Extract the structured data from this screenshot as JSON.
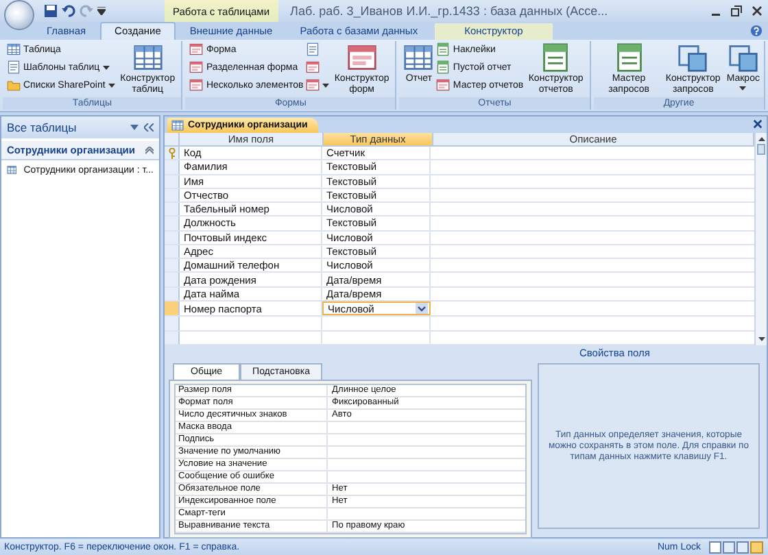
{
  "title_bar": {
    "contextual_tab": "Работа с таблицами",
    "title": "Лаб. раб. 3_Иванов И.И._гр.1433 : база данных (Acce..."
  },
  "ribbon_tabs": [
    {
      "label": "Главная",
      "selected": false
    },
    {
      "label": "Создание",
      "selected": true
    },
    {
      "label": "Внешние данные",
      "selected": false
    },
    {
      "label": "Работа с базами данных",
      "selected": false
    },
    {
      "label": "Конструктор",
      "selected": false
    }
  ],
  "ribbon_groups": [
    {
      "label": "Таблицы",
      "columns": [
        [
          {
            "kind": "small",
            "label": "Таблица",
            "dropdown": false
          },
          {
            "kind": "small",
            "label": "Шаблоны таблиц",
            "dropdown": true
          },
          {
            "kind": "small",
            "label": "Списки SharePoint",
            "dropdown": true
          }
        ],
        [
          {
            "kind": "large",
            "label": "Конструктор таблиц",
            "dropdown": false
          }
        ]
      ]
    },
    {
      "label": "Формы",
      "columns": [
        [
          {
            "kind": "small",
            "label": "Форма",
            "dropdown": false
          },
          {
            "kind": "small",
            "label": "Разделенная форма",
            "dropdown": false
          },
          {
            "kind": "small",
            "label": "Несколько элементов",
            "dropdown": false
          }
        ],
        [
          {
            "kind": "icon",
            "dropdown": false
          },
          {
            "kind": "icon",
            "dropdown": false
          },
          {
            "kind": "icon",
            "dropdown": true
          }
        ],
        [
          {
            "kind": "large",
            "label": "Конструктор форм",
            "dropdown": false
          }
        ]
      ]
    },
    {
      "label": "Отчеты",
      "columns": [
        [
          {
            "kind": "large",
            "label": "Отчет",
            "dropdown": false
          }
        ],
        [
          {
            "kind": "small",
            "label": "Наклейки",
            "dropdown": false
          },
          {
            "kind": "small",
            "label": "Пустой отчет",
            "dropdown": false
          },
          {
            "kind": "small",
            "label": "Мастер отчетов",
            "dropdown": false
          }
        ],
        [
          {
            "kind": "large",
            "label": "Конструктор отчетов",
            "dropdown": false
          }
        ]
      ]
    },
    {
      "label": "Другие",
      "columns": [
        [
          {
            "kind": "large",
            "label": "Мастер запросов",
            "dropdown": false
          }
        ],
        [
          {
            "kind": "large",
            "label": "Конструктор запросов",
            "dropdown": false
          }
        ],
        [
          {
            "kind": "large",
            "label": "Макрос",
            "dropdown": true
          }
        ]
      ]
    }
  ],
  "nav_pane": {
    "header": "Все таблицы",
    "groups": [
      {
        "label": "Сотрудники организации",
        "expanded": true,
        "items": [
          {
            "label": "Сотрудники организации : т..."
          }
        ]
      }
    ]
  },
  "document_tab": {
    "label": "Сотрудники организации"
  },
  "field_table": {
    "columns": [
      {
        "label": "Имя поля",
        "active": false
      },
      {
        "label": "Тип данных",
        "active": true
      },
      {
        "label": "Описание",
        "active": false
      }
    ],
    "rows": [
      {
        "name": "Код",
        "type": "Счетчик",
        "primary_key": true,
        "selected": false
      },
      {
        "name": "Фамилия",
        "type": "Текстовый",
        "primary_key": false,
        "selected": false
      },
      {
        "name": "Имя",
        "type": "Текстовый",
        "primary_key": false,
        "selected": false
      },
      {
        "name": "Отчество",
        "type": "Текстовый",
        "primary_key": false,
        "selected": false
      },
      {
        "name": "Табельный номер",
        "type": "Числовой",
        "primary_key": false,
        "selected": false
      },
      {
        "name": "Должность",
        "type": "Текстовый",
        "primary_key": false,
        "selected": false
      },
      {
        "name": "Почтовый индекс",
        "type": "Числовой",
        "primary_key": false,
        "selected": false
      },
      {
        "name": "Адрес",
        "type": "Текстовый",
        "primary_key": false,
        "selected": false
      },
      {
        "name": "Домашний телефон",
        "type": "Числовой",
        "primary_key": false,
        "selected": false
      },
      {
        "name": "Дата рождения",
        "type": "Дата/время",
        "primary_key": false,
        "selected": false
      },
      {
        "name": "Дата найма",
        "type": "Дата/время",
        "primary_key": false,
        "selected": false
      },
      {
        "name": "Номер паспорта",
        "type": "Числовой",
        "primary_key": false,
        "selected": true
      }
    ]
  },
  "field_properties": {
    "title": "Свойства поля",
    "tabs": [
      {
        "label": "Общие",
        "selected": true
      },
      {
        "label": "Подстановка",
        "selected": false
      }
    ],
    "rows": [
      {
        "label": "Размер поля",
        "value": "Длинное целое"
      },
      {
        "label": "Формат поля",
        "value": "Фиксированный"
      },
      {
        "label": "Число десятичных знаков",
        "value": "Авто"
      },
      {
        "label": "Маска ввода"
      },
      {
        "label": "Подпись"
      },
      {
        "label": "Значение по умолчанию"
      },
      {
        "label": "Условие на значение"
      },
      {
        "label": "Сообщение об ошибке"
      },
      {
        "label": "Обязательное поле",
        "value": "Нет"
      },
      {
        "label": "Индексированное поле",
        "value": "Нет"
      },
      {
        "label": "Смарт-теги"
      },
      {
        "label": "Выравнивание текста",
        "value": "По правому краю"
      }
    ],
    "help": "Тип данных определяет значения, которые можно сохранять в этом поле.  Для справки по типам данных нажмите клавишу F1."
  },
  "status_bar": {
    "text": "Конструктор.  F6 = переключение окон.  F1 = справка.",
    "indicator": "Num Lock"
  }
}
